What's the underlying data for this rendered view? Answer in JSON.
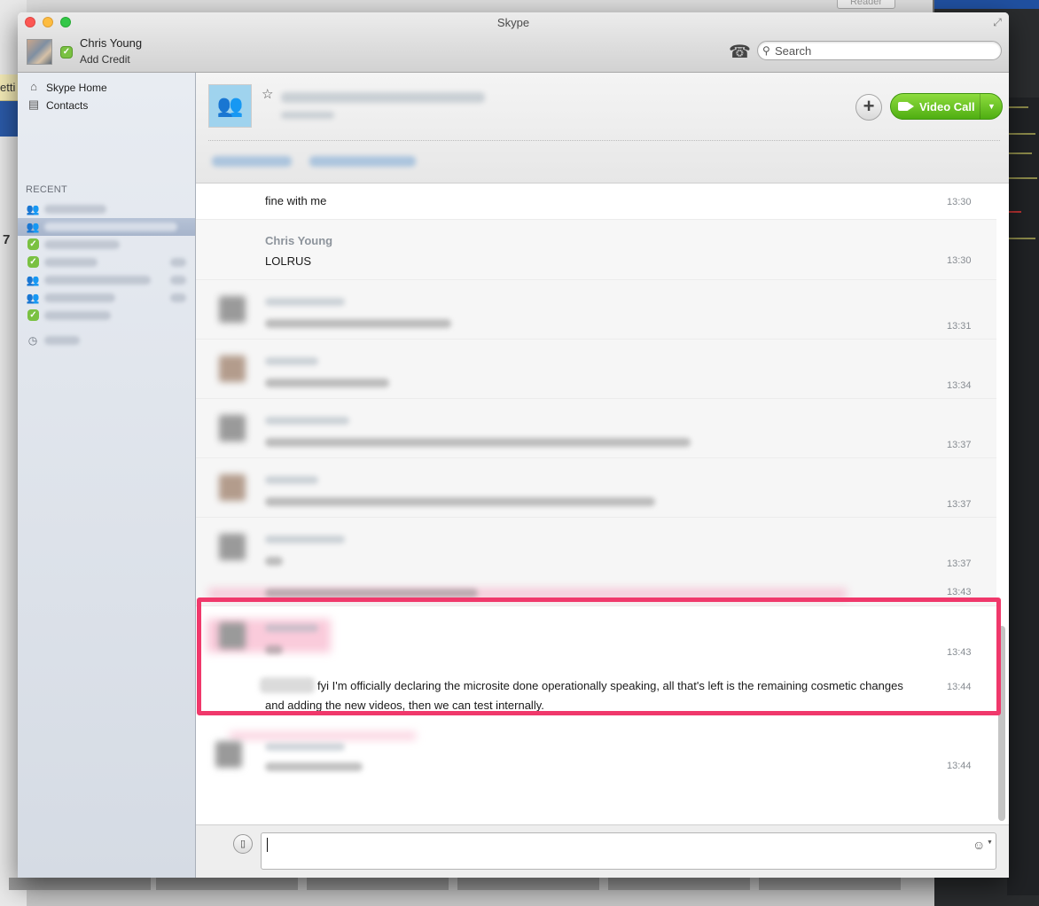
{
  "background": {
    "left_fragment_text": "etti",
    "left_number": "7",
    "reader_button": "Reader"
  },
  "window": {
    "title": "Skype"
  },
  "profile": {
    "name": "Chris Young",
    "add_credit": "Add Credit",
    "status": "online"
  },
  "search": {
    "placeholder": "Search"
  },
  "sidebar": {
    "nav": [
      {
        "label": "Skype Home",
        "icon": "home-icon"
      },
      {
        "label": "Contacts",
        "icon": "contacts-icon"
      }
    ],
    "recent_heading": "RECENT",
    "recent_icons": [
      "group-icon",
      "group-icon",
      "online-status-icon",
      "online-status-icon",
      "group-icon",
      "group-icon",
      "online-status-icon",
      "history-icon"
    ]
  },
  "header": {
    "video_call_label": "Video Call",
    "add_label": "+"
  },
  "messages": [
    {
      "author": "",
      "text": "fine with me",
      "time": "13:30"
    },
    {
      "author": "Chris Young",
      "text": "LOLRUS",
      "time": "13:30"
    },
    {
      "author": "",
      "text": "",
      "time": "13:31"
    },
    {
      "author": "",
      "text": "",
      "time": "13:34"
    },
    {
      "author": "",
      "text": "",
      "time": "13:37"
    },
    {
      "author": "",
      "text": "",
      "time": "13:37"
    },
    {
      "author": "",
      "text": "",
      "time": "13:37"
    },
    {
      "author": "",
      "text": "",
      "time": "13:43"
    },
    {
      "author": "",
      "text": "",
      "time": "13:43"
    },
    {
      "author": "",
      "text": "fyi I'm officially declaring the microsite done operationally speaking, all that's left is the remaining cosmetic changes",
      "text_line2": "and adding the new videos, then we can test internally.",
      "time": "13:44"
    },
    {
      "author": "",
      "text": "",
      "time": "13:44"
    }
  ],
  "colors": {
    "video_call_green": "#5dc21a",
    "status_green": "#7ac142",
    "highlight_pink": "#f0386b",
    "sidebar_bg": "#dde2ea"
  }
}
